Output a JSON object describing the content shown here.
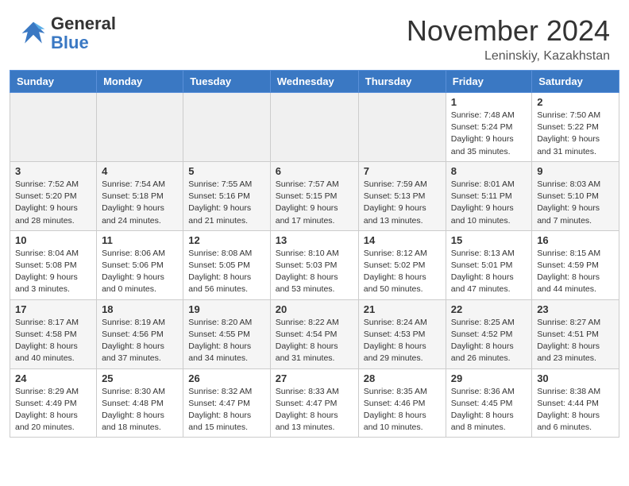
{
  "header": {
    "logo_line1": "General",
    "logo_line2": "Blue",
    "month": "November 2024",
    "location": "Leninskiy, Kazakhstan"
  },
  "days_of_week": [
    "Sunday",
    "Monday",
    "Tuesday",
    "Wednesday",
    "Thursday",
    "Friday",
    "Saturday"
  ],
  "weeks": [
    [
      {
        "num": "",
        "info": ""
      },
      {
        "num": "",
        "info": ""
      },
      {
        "num": "",
        "info": ""
      },
      {
        "num": "",
        "info": ""
      },
      {
        "num": "",
        "info": ""
      },
      {
        "num": "1",
        "info": "Sunrise: 7:48 AM\nSunset: 5:24 PM\nDaylight: 9 hours and 35 minutes."
      },
      {
        "num": "2",
        "info": "Sunrise: 7:50 AM\nSunset: 5:22 PM\nDaylight: 9 hours and 31 minutes."
      }
    ],
    [
      {
        "num": "3",
        "info": "Sunrise: 7:52 AM\nSunset: 5:20 PM\nDaylight: 9 hours and 28 minutes."
      },
      {
        "num": "4",
        "info": "Sunrise: 7:54 AM\nSunset: 5:18 PM\nDaylight: 9 hours and 24 minutes."
      },
      {
        "num": "5",
        "info": "Sunrise: 7:55 AM\nSunset: 5:16 PM\nDaylight: 9 hours and 21 minutes."
      },
      {
        "num": "6",
        "info": "Sunrise: 7:57 AM\nSunset: 5:15 PM\nDaylight: 9 hours and 17 minutes."
      },
      {
        "num": "7",
        "info": "Sunrise: 7:59 AM\nSunset: 5:13 PM\nDaylight: 9 hours and 13 minutes."
      },
      {
        "num": "8",
        "info": "Sunrise: 8:01 AM\nSunset: 5:11 PM\nDaylight: 9 hours and 10 minutes."
      },
      {
        "num": "9",
        "info": "Sunrise: 8:03 AM\nSunset: 5:10 PM\nDaylight: 9 hours and 7 minutes."
      }
    ],
    [
      {
        "num": "10",
        "info": "Sunrise: 8:04 AM\nSunset: 5:08 PM\nDaylight: 9 hours and 3 minutes."
      },
      {
        "num": "11",
        "info": "Sunrise: 8:06 AM\nSunset: 5:06 PM\nDaylight: 9 hours and 0 minutes."
      },
      {
        "num": "12",
        "info": "Sunrise: 8:08 AM\nSunset: 5:05 PM\nDaylight: 8 hours and 56 minutes."
      },
      {
        "num": "13",
        "info": "Sunrise: 8:10 AM\nSunset: 5:03 PM\nDaylight: 8 hours and 53 minutes."
      },
      {
        "num": "14",
        "info": "Sunrise: 8:12 AM\nSunset: 5:02 PM\nDaylight: 8 hours and 50 minutes."
      },
      {
        "num": "15",
        "info": "Sunrise: 8:13 AM\nSunset: 5:01 PM\nDaylight: 8 hours and 47 minutes."
      },
      {
        "num": "16",
        "info": "Sunrise: 8:15 AM\nSunset: 4:59 PM\nDaylight: 8 hours and 44 minutes."
      }
    ],
    [
      {
        "num": "17",
        "info": "Sunrise: 8:17 AM\nSunset: 4:58 PM\nDaylight: 8 hours and 40 minutes."
      },
      {
        "num": "18",
        "info": "Sunrise: 8:19 AM\nSunset: 4:56 PM\nDaylight: 8 hours and 37 minutes."
      },
      {
        "num": "19",
        "info": "Sunrise: 8:20 AM\nSunset: 4:55 PM\nDaylight: 8 hours and 34 minutes."
      },
      {
        "num": "20",
        "info": "Sunrise: 8:22 AM\nSunset: 4:54 PM\nDaylight: 8 hours and 31 minutes."
      },
      {
        "num": "21",
        "info": "Sunrise: 8:24 AM\nSunset: 4:53 PM\nDaylight: 8 hours and 29 minutes."
      },
      {
        "num": "22",
        "info": "Sunrise: 8:25 AM\nSunset: 4:52 PM\nDaylight: 8 hours and 26 minutes."
      },
      {
        "num": "23",
        "info": "Sunrise: 8:27 AM\nSunset: 4:51 PM\nDaylight: 8 hours and 23 minutes."
      }
    ],
    [
      {
        "num": "24",
        "info": "Sunrise: 8:29 AM\nSunset: 4:49 PM\nDaylight: 8 hours and 20 minutes."
      },
      {
        "num": "25",
        "info": "Sunrise: 8:30 AM\nSunset: 4:48 PM\nDaylight: 8 hours and 18 minutes."
      },
      {
        "num": "26",
        "info": "Sunrise: 8:32 AM\nSunset: 4:47 PM\nDaylight: 8 hours and 15 minutes."
      },
      {
        "num": "27",
        "info": "Sunrise: 8:33 AM\nSunset: 4:47 PM\nDaylight: 8 hours and 13 minutes."
      },
      {
        "num": "28",
        "info": "Sunrise: 8:35 AM\nSunset: 4:46 PM\nDaylight: 8 hours and 10 minutes."
      },
      {
        "num": "29",
        "info": "Sunrise: 8:36 AM\nSunset: 4:45 PM\nDaylight: 8 hours and 8 minutes."
      },
      {
        "num": "30",
        "info": "Sunrise: 8:38 AM\nSunset: 4:44 PM\nDaylight: 8 hours and 6 minutes."
      }
    ]
  ]
}
